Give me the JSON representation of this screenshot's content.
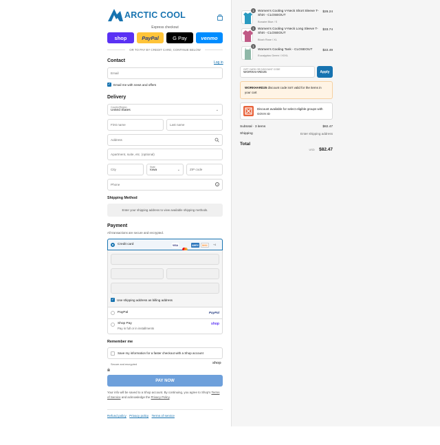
{
  "brand": {
    "name": "ARCTIC COOL",
    "color": "#1773b0"
  },
  "header": {
    "cart_icon": "bag-icon"
  },
  "express": {
    "label": "Express checkout",
    "buttons": [
      {
        "label": "shop",
        "color": "#5a31f4"
      },
      {
        "label": "PayPal",
        "color": "#ffc439"
      },
      {
        "label": "G Pay",
        "color": "#000000"
      },
      {
        "label": "venmo",
        "color": "#008cff"
      }
    ],
    "divider": "OR TO PAY BY CREDIT CARD, CONTINUE BELOW"
  },
  "contact": {
    "title": "Contact",
    "login_link": "Log in",
    "email_placeholder": "Email",
    "news_label": "Email me with news and offers",
    "news_checked": true
  },
  "delivery": {
    "title": "Delivery",
    "country_label": "Country/Region",
    "country_value": "United States",
    "first_name": "First name",
    "last_name": "Last name",
    "address": "Address",
    "apartment": "Apartment, suite, etc. (optional)",
    "city": "City",
    "state_label": "State",
    "state_value": "Iowa",
    "zip": "ZIP code",
    "phone": "Phone"
  },
  "shipping_method": {
    "title": "Shipping Method",
    "message": "Enter your shipping address to view available shipping methods."
  },
  "payment": {
    "title": "Payment",
    "subtitle": "All transactions are secure and encrypted.",
    "credit_card_label": "Credit card",
    "card_logos": [
      "VISA",
      "MC",
      "AMEX",
      "DISC",
      "+4"
    ],
    "billing_label": "Use shipping address as billing address",
    "billing_checked": true,
    "paypal_label": "PayPal",
    "paypal_logo": "PayPal",
    "shoppay_label": "Shop Pay",
    "shoppay_sub": "Pay in full or in installments",
    "shoppay_logo": "shop"
  },
  "remember": {
    "title": "Remember me",
    "save_label": "Save my information for a faster checkout with a Shop account",
    "secure_label": "Secure and encrypted",
    "shop_logo": "shop"
  },
  "pay_now": {
    "label": "PAY NOW",
    "color": "#6ea0db"
  },
  "legal": {
    "text_prefix": "Your info will be saved to a Shop account. By continuing, you agree to Shop's",
    "terms_link": "Terms of Service",
    "text_mid": "and acknowledge the",
    "privacy_link": "Privacy Policy",
    "text_suffix": "."
  },
  "footer_links": [
    "Refund policy",
    "Privacy policy",
    "Terms of service"
  ],
  "cart": {
    "items": [
      {
        "qty": "1",
        "name": "Women's Cooling V-Neck Short Sleeve T-Shirt - CLOSEOUT",
        "variant": "Bonaire Blue / S",
        "price": "$26.24",
        "color": "#2a9ac0"
      },
      {
        "qty": "1",
        "name": "Women's Cooling V-Neck Long Sleeve T-Shirt - CLOSEOUT",
        "variant": "Blush Rose / XL",
        "price": "$33.74",
        "color": "#c05a86"
      },
      {
        "qty": "1",
        "name": "Women's Cooling Tank - CLOSEOUT",
        "variant": "Eucalyptus Green / XXXL",
        "price": "$22.49",
        "color": "#8fb8a8"
      }
    ],
    "discount_label": "Gift card or discount code",
    "discount_value": "WORKHARD25",
    "apply_label": "Apply",
    "apply_color": "#1773b0",
    "warning_code": "WORKHARD25",
    "warning_text": "discount code isn't valid for the items in your cart",
    "govx_text": "Discount available for select eligible groups with GOVX ID",
    "subtotal_label": "Subtotal · 3 items",
    "subtotal_value": "$82.47",
    "shipping_label": "Shipping",
    "shipping_value": "Enter shipping address",
    "total_label": "Total",
    "currency": "USD",
    "total_value": "$82.47"
  }
}
